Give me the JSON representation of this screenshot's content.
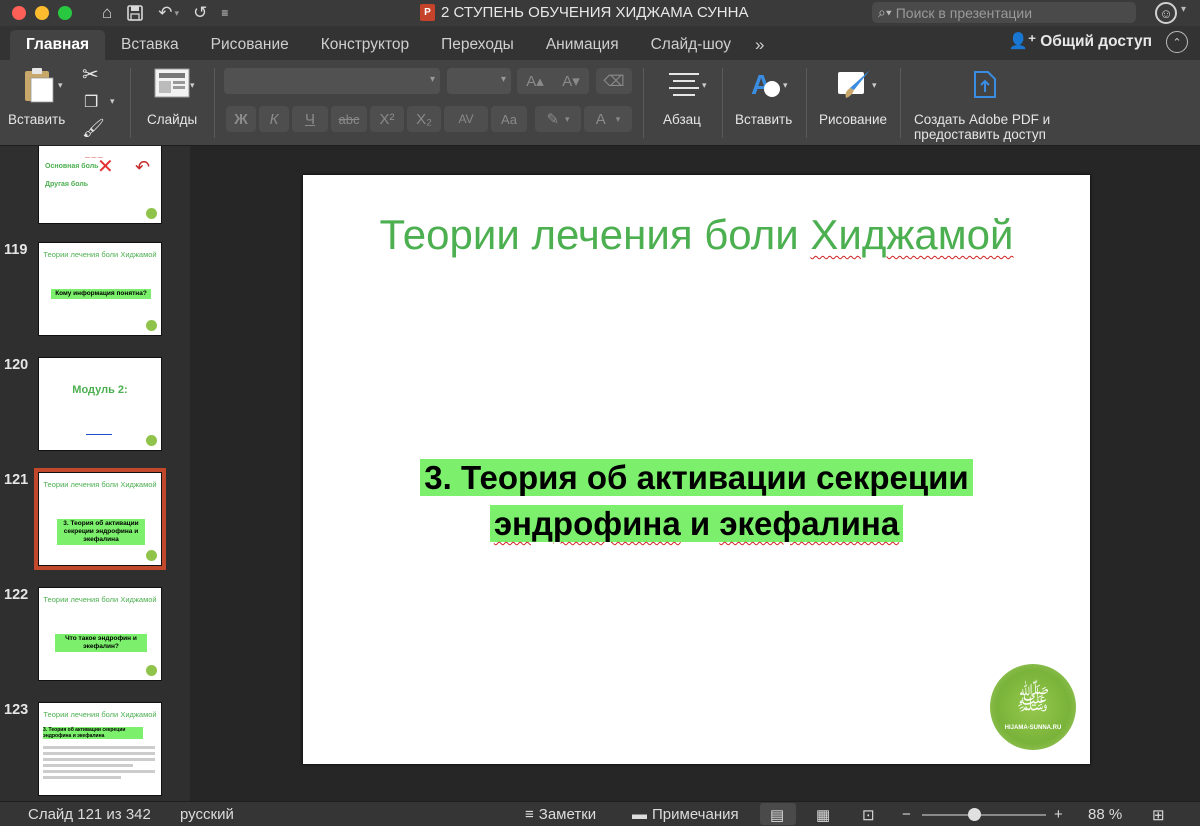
{
  "window": {
    "title": "2 СТУПЕНЬ ОБУЧЕНИЯ ХИДЖАМА СУННА",
    "app_badge": "P"
  },
  "search": {
    "placeholder": "Поиск в презентации"
  },
  "tabs": [
    {
      "label": "Главная",
      "active": true
    },
    {
      "label": "Вставка"
    },
    {
      "label": "Рисование"
    },
    {
      "label": "Конструктор"
    },
    {
      "label": "Переходы"
    },
    {
      "label": "Анимация"
    },
    {
      "label": "Слайд-шоу"
    }
  ],
  "share_label": "Общий доступ",
  "ribbon": {
    "paste": "Вставить",
    "slides": "Слайды",
    "paragraph": "Абзац",
    "insert": "Вставить",
    "drawing": "Рисование",
    "adobe_line1": "Создать Adobe PDF и",
    "adobe_line2": "предоставить доступ",
    "fmt": {
      "bold": "Ж",
      "italic": "К",
      "underline": "Ч",
      "strike": "abc",
      "sup": "X²",
      "sub": "X₂",
      "spacing": "AV",
      "case": "Aa",
      "grow": "A▴",
      "shrink": "A▾",
      "color": "A"
    }
  },
  "thumbnails": [
    {
      "num": "",
      "title": "",
      "lines": [
        "Основная боль",
        "Другая боль"
      ]
    },
    {
      "num": "119",
      "title": "Теории лечения боли Хиджамой",
      "highlight": "Кому информация понятна?"
    },
    {
      "num": "120",
      "title": "",
      "module": "Модуль 2:"
    },
    {
      "num": "121",
      "title": "Теории лечения боли Хиджамой",
      "highlight": "3. Теория об активации секреции эндрофина и экефалина",
      "selected": true
    },
    {
      "num": "122",
      "title": "Теории лечения боли Хиджамой",
      "highlight": "Что такое эндрофин и экефалин?"
    },
    {
      "num": "123",
      "title": "Теории лечения боли Хиджамой",
      "highlight": "3. Теория об активации секреции эндрофина и экефалина"
    }
  ],
  "slide": {
    "title_part1": "Теории лечения боли ",
    "title_part2": "Хиджамой",
    "body_line1": "3. Теория об активации секреции",
    "body_line2_a": "эндрофина",
    "body_line2_b": " и ",
    "body_line2_c": "экефалина",
    "logo_site": "HIJAMA-SUNNA.RU"
  },
  "status": {
    "slide_counter": "Слайд 121 из 342",
    "language": "русский",
    "notes": "Заметки",
    "comments": "Примечания",
    "zoom": "88 %"
  }
}
